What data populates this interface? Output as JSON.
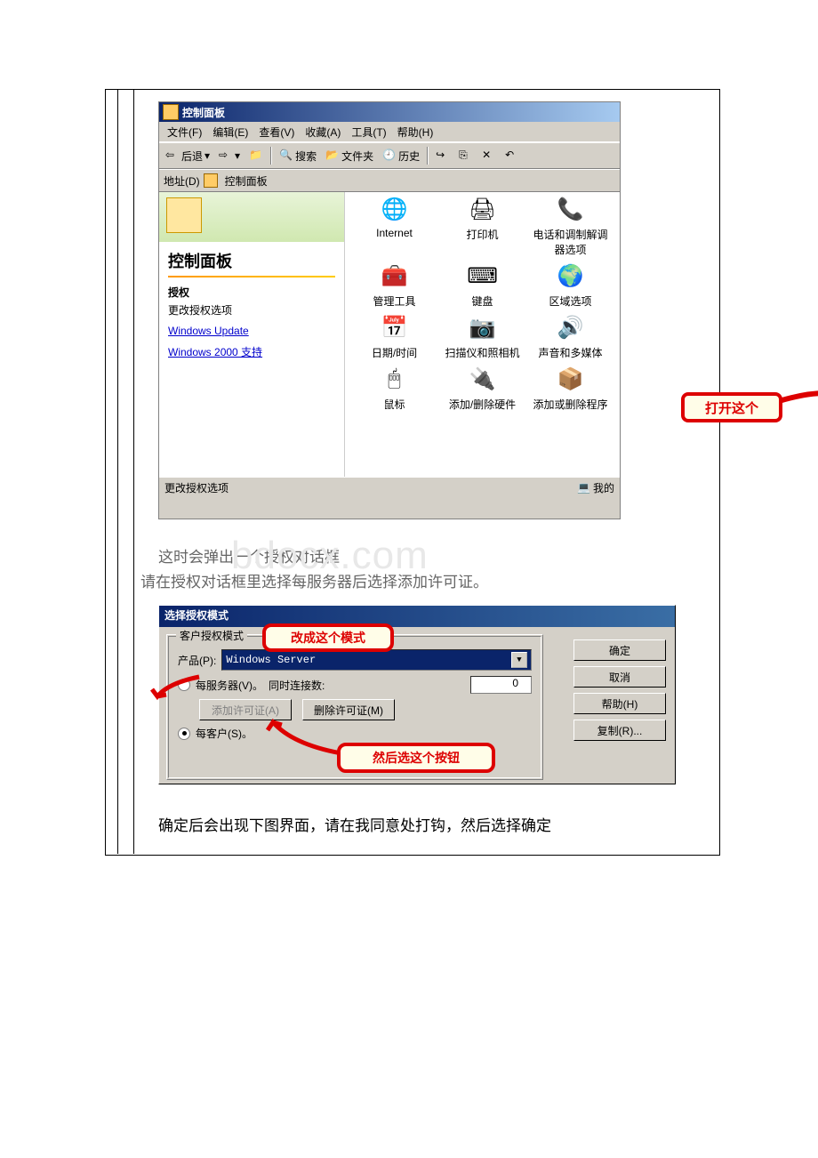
{
  "cp": {
    "title": "控制面板",
    "menu": {
      "file": "文件(F)",
      "edit": "编辑(E)",
      "view": "查看(V)",
      "fav": "收藏(A)",
      "tools": "工具(T)",
      "help": "帮助(H)"
    },
    "tb": {
      "back": "后退",
      "search": "搜索",
      "folders": "文件夹",
      "history": "历史"
    },
    "addr_label": "地址(D)",
    "addr_val": "控制面板",
    "lp": {
      "title": "控制面板",
      "sub_t": "授权",
      "sub_d": "更改授权选项",
      "link1": "Windows Update",
      "link2": "Windows 2000 支持"
    },
    "icons": {
      "r1": [
        "Internet",
        "打印机",
        "电话和调制解调器选项"
      ],
      "r2": [
        "管理工具",
        "键盘",
        "区域选项"
      ],
      "r3": [
        "日期/时间",
        "扫描仪和照相机",
        "声音和多媒体"
      ],
      "r4": [
        "鼠标",
        "添加/删除硬件",
        "添加或删除程序"
      ]
    },
    "status_l": "更改授权选项",
    "status_r": "我的"
  },
  "anno": {
    "open": "打开这个",
    "mode": "改成这个模式",
    "btn": "然后选这个按钮"
  },
  "body": {
    "t1": "这时会弹出一个授权对话框",
    "t2": "请在授权对话框里选择每服务器后选择添加许可证。",
    "t3": "确定后会出现下图界面，请在我同意处打钩，然后选择确定",
    "wm": "bdocx.com"
  },
  "dlg": {
    "title": "选择授权模式",
    "grp": "客户授权模式",
    "product_lbl": "产品(P):",
    "product_val": "Windows Server",
    "per_server": "每服务器(V)。",
    "conn_lbl": "同时连接数:",
    "conn_val": "0",
    "add_btn": "添加许可证(A)",
    "del_btn": "删除许可证(M)",
    "per_seat": "每客户(S)。",
    "ok": "确定",
    "cancel": "取消",
    "help": "帮助(H)",
    "copy": "复制(R)..."
  }
}
